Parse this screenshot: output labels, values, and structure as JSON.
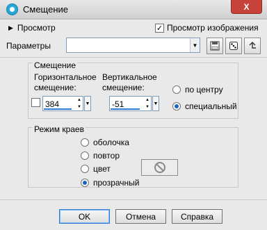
{
  "window": {
    "title": "Смещение",
    "close_label": "X"
  },
  "preview": {
    "label": "Просмотр",
    "image_preview_label": "Просмотр изображения",
    "image_preview_checked": true
  },
  "params": {
    "label": "Параметры",
    "value": ""
  },
  "offset": {
    "group_title": "Смещение",
    "horizontal_label_1": "Горизонтальное",
    "horizontal_label_2": "смещение:",
    "horizontal_value": "384",
    "vertical_label_1": "Вертикальное",
    "vertical_label_2": "смещение:",
    "vertical_value": "-51",
    "options": [
      {
        "label": "по центру",
        "selected": false
      },
      {
        "label": "специальный",
        "selected": true
      }
    ]
  },
  "edge_mode": {
    "group_title": "Режим краев",
    "options": [
      {
        "label": "оболочка",
        "selected": false
      },
      {
        "label": "повтор",
        "selected": false
      },
      {
        "label": "цвет",
        "selected": false
      },
      {
        "label": "прозрачный",
        "selected": true
      }
    ]
  },
  "buttons": {
    "ok": "OK",
    "cancel": "Отмена",
    "help": "Справка"
  }
}
